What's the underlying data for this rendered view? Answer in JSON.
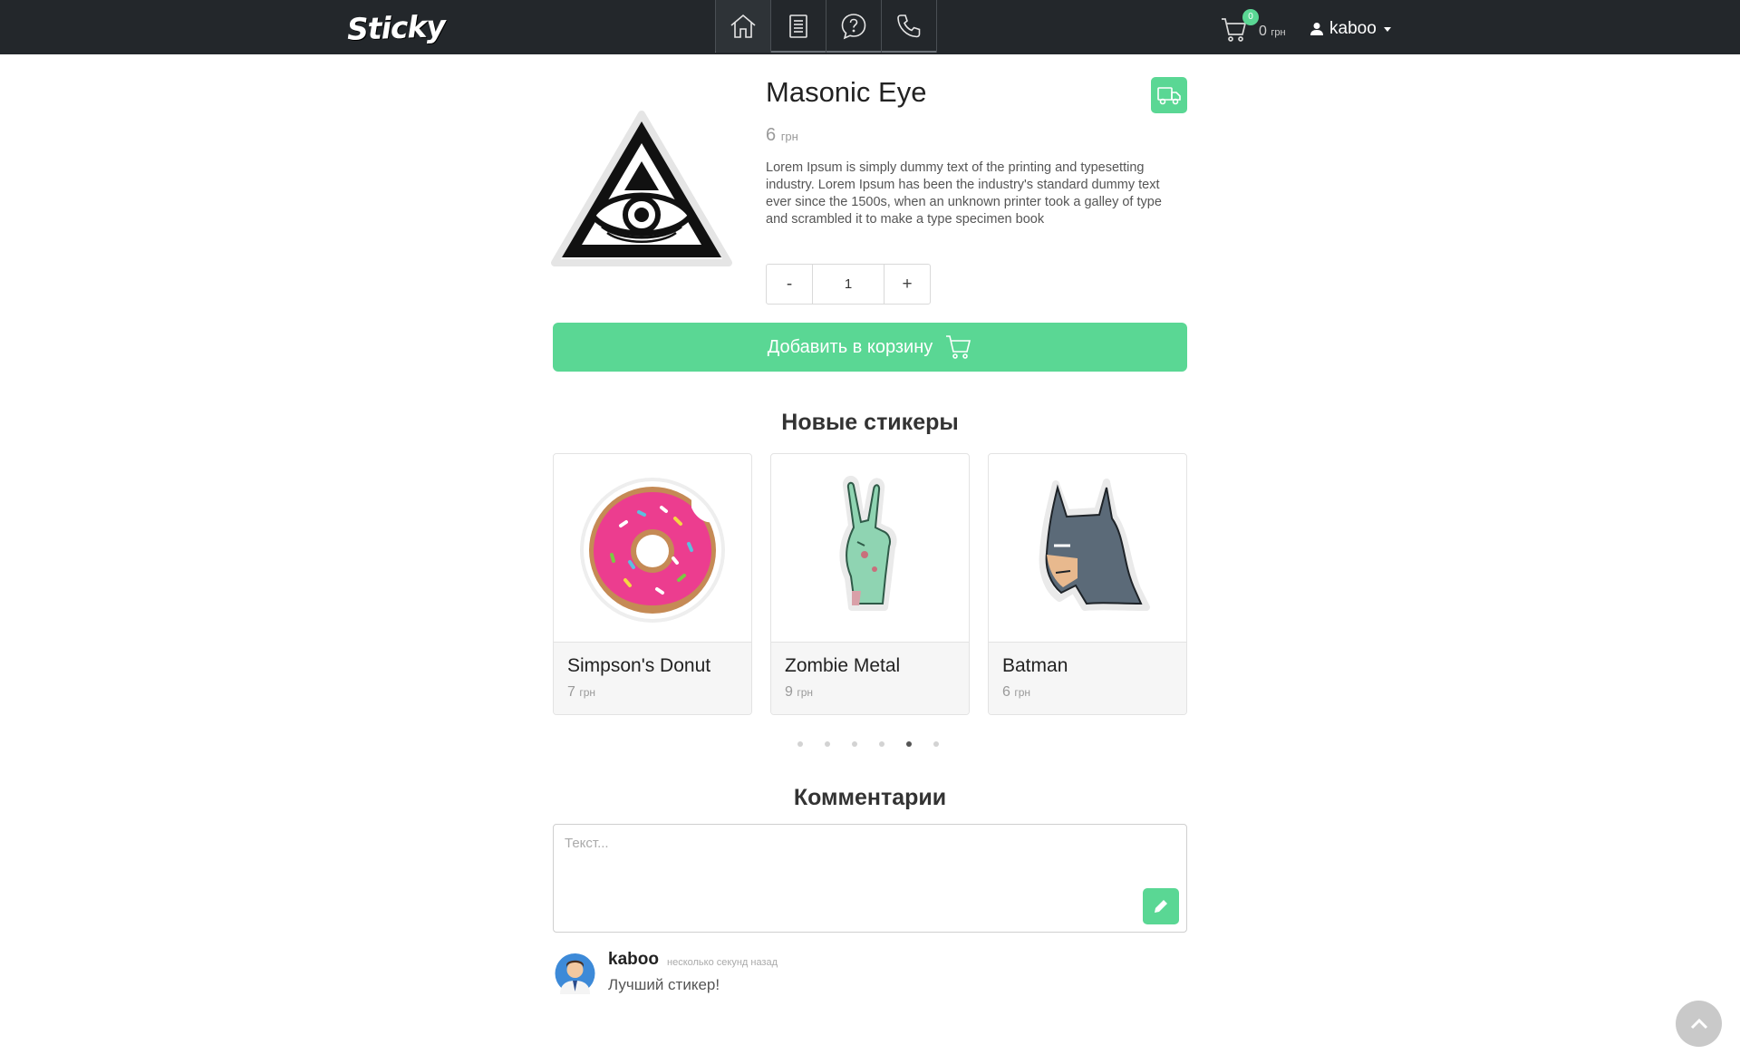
{
  "brand": {
    "logo": "Sticky",
    "accent_color": "#5ad794",
    "navbar_color": "#23272b"
  },
  "nav": {
    "items": [
      {
        "icon": "home-icon",
        "active": true
      },
      {
        "icon": "catalog-icon",
        "active": false
      },
      {
        "icon": "help-icon",
        "active": false
      },
      {
        "icon": "phone-icon",
        "active": false
      }
    ],
    "cart": {
      "count": "0",
      "total": "0",
      "currency": "грн"
    },
    "user": {
      "name": "kaboo"
    }
  },
  "product": {
    "title": "Masonic Eye",
    "price": "6",
    "currency": "грн",
    "description": "Lorem Ipsum is simply dummy text of the printing and typesetting industry. Lorem Ipsum has been the industry's standard dummy text ever since the 1500s, when an unknown printer took a galley of type and scrambled it to make a type specimen book",
    "quantity": "1",
    "minus_label": "-",
    "plus_label": "+",
    "add_to_cart_label": "Добавить в корзину",
    "image_icon": "eye-of-providence-icon",
    "delivery_icon": "truck-icon"
  },
  "new_stickers": {
    "title": "Новые стикеры",
    "items": [
      {
        "name": "Simpson's Donut",
        "price": "7",
        "currency": "грн",
        "icon": "donut-icon"
      },
      {
        "name": "Zombie Metal",
        "price": "9",
        "currency": "грн",
        "icon": "zombie-hand-icon"
      },
      {
        "name": "Batman",
        "price": "6",
        "currency": "грн",
        "icon": "batman-icon"
      }
    ],
    "pagination": {
      "total": 6,
      "active_index": 5
    }
  },
  "comments": {
    "title": "Комментарии",
    "placeholder": "Текст...",
    "list": [
      {
        "author": "kaboo",
        "time": "несколько секунд назад",
        "text": "Лучший стикер!"
      }
    ]
  }
}
